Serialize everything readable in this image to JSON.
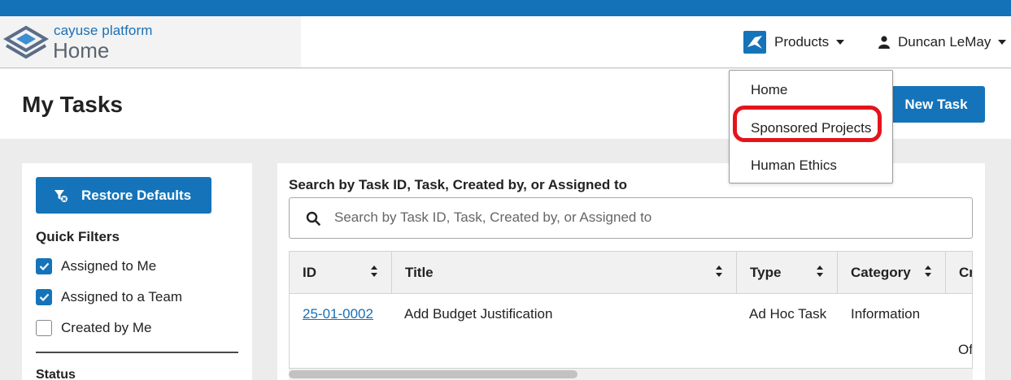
{
  "header": {
    "brand_name": "cayuse platform",
    "brand_page": "Home",
    "products_label": "Products",
    "user_name": "Duncan LeMay"
  },
  "page": {
    "title": "My Tasks",
    "new_task_label": "New Task"
  },
  "products_menu": {
    "items": [
      "Home",
      "Sponsored Projects",
      "Human Ethics"
    ]
  },
  "sidebar": {
    "restore_label": "Restore Defaults",
    "quick_filters_label": "Quick Filters",
    "filters": [
      {
        "label": "Assigned to Me",
        "checked": true
      },
      {
        "label": "Assigned to a Team",
        "checked": true
      },
      {
        "label": "Created by Me",
        "checked": false
      }
    ],
    "status_label": "Status"
  },
  "search": {
    "label": "Search by Task ID, Task, Created by, or Assigned to",
    "placeholder": "Search by Task ID, Task, Created by, or Assigned to",
    "value": ""
  },
  "table": {
    "columns": [
      "ID",
      "Title",
      "Type",
      "Category",
      "Cr"
    ],
    "rows": [
      {
        "id": "25-01-0002",
        "title": "Add Budget Justification",
        "type": "Ad Hoc Task",
        "category": "Information",
        "extra": "Of"
      }
    ]
  },
  "colors": {
    "primary": "#1574b9",
    "highlight": "#e4141c"
  },
  "icons": [
    "cayuse-logo-icon",
    "products-app-icon",
    "person-icon",
    "filter-reset-icon",
    "check-icon",
    "search-icon",
    "sort-icon"
  ]
}
